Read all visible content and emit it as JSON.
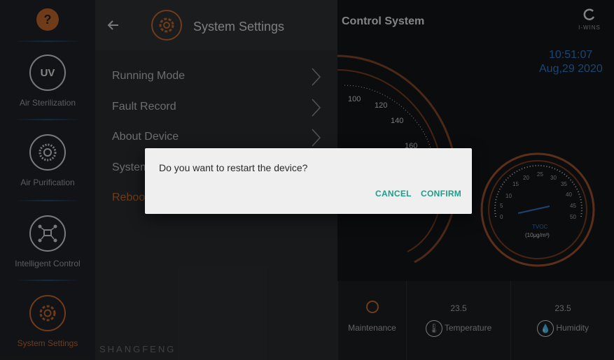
{
  "sidebar": {
    "items": [
      {
        "label": "Air Sterilization",
        "icon": "uv-icon",
        "badge": "UV"
      },
      {
        "label": "Air Purification",
        "icon": "fan-icon"
      },
      {
        "label": "Intelligent Control",
        "icon": "network-control-icon"
      },
      {
        "label": "System Settings",
        "icon": "gear-icon",
        "active": true
      }
    ],
    "top_icon": "help-icon",
    "top_icon_glyph": "?"
  },
  "settings": {
    "title": "System Settings",
    "back_icon": "back-arrow-icon",
    "menu": [
      {
        "label": "Running Mode"
      },
      {
        "label": "Fault Record"
      },
      {
        "label": "About Device"
      },
      {
        "label": "System"
      },
      {
        "label": "Reboot"
      }
    ],
    "footer_brand": "SHANGFENG"
  },
  "dashboard": {
    "title": "Control System",
    "logo_text": "I-WINS",
    "time": "10:51:07",
    "date": "Aug,29 2020",
    "big_gauge_ticks": [
      "100",
      "120",
      "140",
      "160"
    ],
    "small_gauge": {
      "ticks": [
        "0",
        "5",
        "10",
        "15",
        "20",
        "25",
        "30",
        "35",
        "40",
        "45",
        "50"
      ],
      "label": "TVOC",
      "unit": "(10μg/m³)"
    },
    "cells": [
      {
        "label": "Maintenance"
      },
      {
        "value": "23.5",
        "label": "Temperature",
        "icon": "thermometer-icon"
      },
      {
        "value": "23.5",
        "label": "Humidity",
        "icon": "humidity-drops-icon"
      }
    ]
  },
  "dialog": {
    "message": "Do you want to restart the device?",
    "cancel": "CANCEL",
    "confirm": "CONFIRM"
  },
  "colors": {
    "accent_orange": "#c2662b",
    "accent_teal": "#1f9d8a",
    "accent_blue": "#2f78c4"
  }
}
